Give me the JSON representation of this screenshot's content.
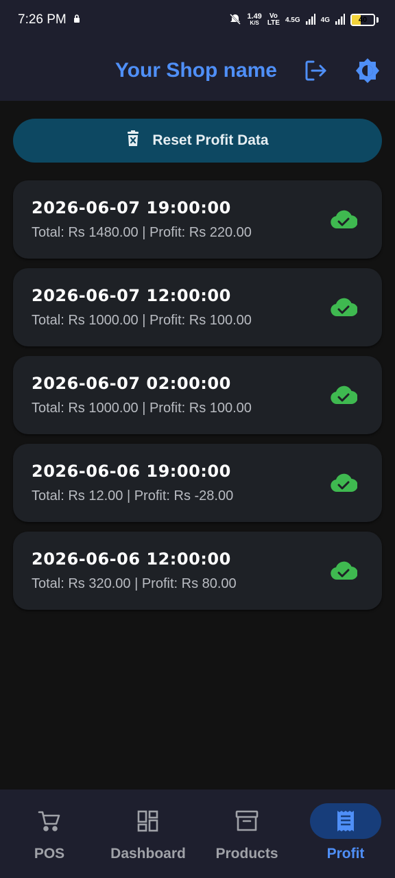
{
  "status_bar": {
    "time": "7:26 PM",
    "speed_value": "1.49",
    "speed_unit": "K/S",
    "vo": "Vo",
    "lte": "LTE",
    "net1": "4.5G",
    "net2": "4G",
    "battery": "40",
    "battery_level": 0.4
  },
  "app_bar": {
    "title": "Your Shop name"
  },
  "reset_button": {
    "label": "Reset Profit Data"
  },
  "records": [
    {
      "date": "2026-06-07 19:00:00",
      "summary": "Total: Rs 1480.00 | Profit: Rs 220.00"
    },
    {
      "date": "2026-06-07 12:00:00",
      "summary": "Total: Rs 1000.00 | Profit: Rs 100.00"
    },
    {
      "date": "2026-06-07 02:00:00",
      "summary": "Total: Rs 1000.00 | Profit: Rs 100.00"
    },
    {
      "date": "2026-06-06 19:00:00",
      "summary": "Total: Rs 12.00 | Profit: Rs -28.00"
    },
    {
      "date": "2026-06-06 12:00:00",
      "summary": "Total: Rs 320.00 | Profit: Rs 80.00"
    }
  ],
  "bottom_nav": {
    "items": [
      {
        "label": "POS",
        "icon": "cart-icon"
      },
      {
        "label": "Dashboard",
        "icon": "dashboard-icon"
      },
      {
        "label": "Products",
        "icon": "archive-icon"
      },
      {
        "label": "Profit",
        "icon": "receipt-icon",
        "active": true
      }
    ]
  },
  "colors": {
    "accent": "#4f8ff7",
    "synced": "#3fb950",
    "reset_button_bg": "#0d4862",
    "card_bg": "#1e2126",
    "bar_bg": "#1e1f2e",
    "page_bg": "#121212"
  }
}
